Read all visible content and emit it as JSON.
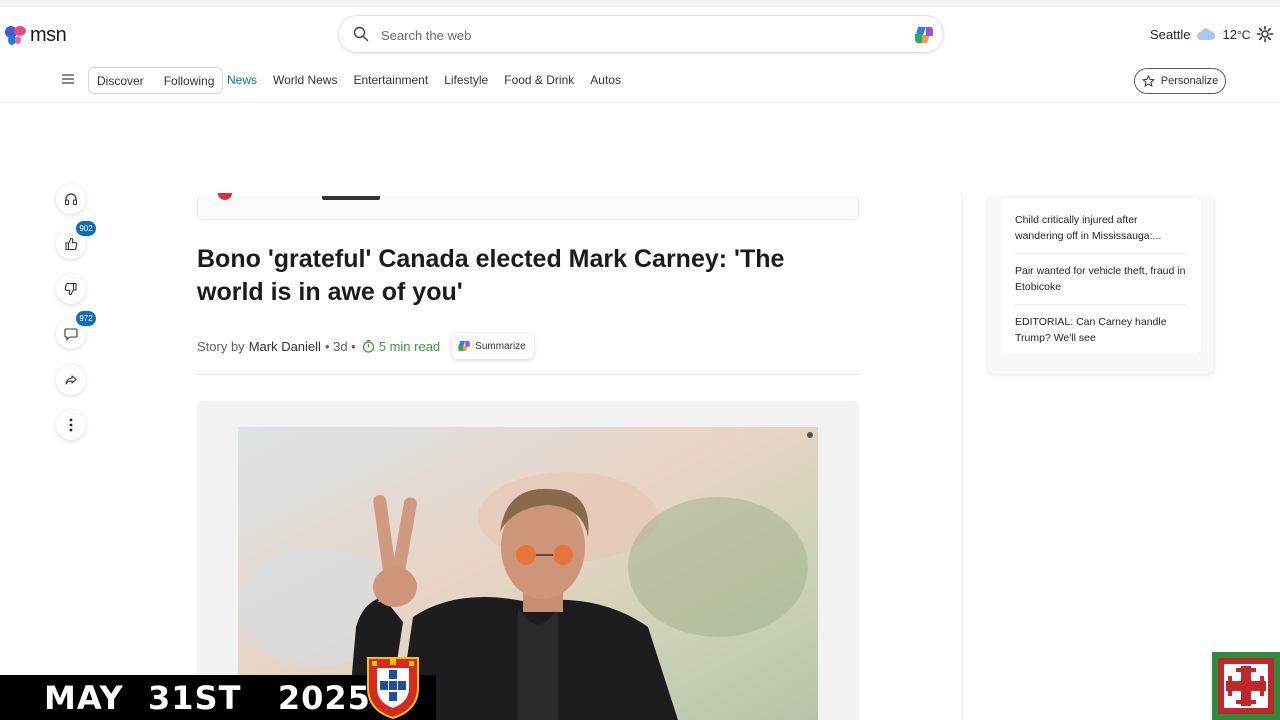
{
  "header": {
    "logo_text": "msn",
    "search_placeholder": "Search the web",
    "weather": {
      "city": "Seattle",
      "temp": "12",
      "unit": "°C"
    }
  },
  "nav": {
    "pills": [
      "Discover",
      "Following"
    ],
    "items": [
      {
        "label": "News",
        "active": true
      },
      {
        "label": "World News",
        "active": false
      },
      {
        "label": "Entertainment",
        "active": false
      },
      {
        "label": "Lifestyle",
        "active": false
      },
      {
        "label": "Food & Drink",
        "active": false
      },
      {
        "label": "Autos",
        "active": false
      }
    ],
    "personalize_label": "Personalize"
  },
  "rail": {
    "like_count": "902",
    "comment_count": "972"
  },
  "article": {
    "headline": "Bono 'grateful' Canada elected Mark Carney: 'The world is in awe of you'",
    "story_by": "Story by",
    "author": "Mark Daniell",
    "age": "• 3d •",
    "read_time": "5 min read",
    "summarize_label": "Summarize"
  },
  "sidebar": {
    "items": [
      "Child critically injured after wandering off in Mississauga:...",
      "Pair wanted for vehicle theft, fraud in Etobicoke",
      "EDITORIAL: Can Carney handle Trump? We'll see"
    ]
  },
  "overlay": {
    "date_text": "MAY  31ST   2025"
  },
  "colors": {
    "accent": "#0f6cbd",
    "read_time": "#3a9a3a",
    "banner_bg": "#000000"
  }
}
